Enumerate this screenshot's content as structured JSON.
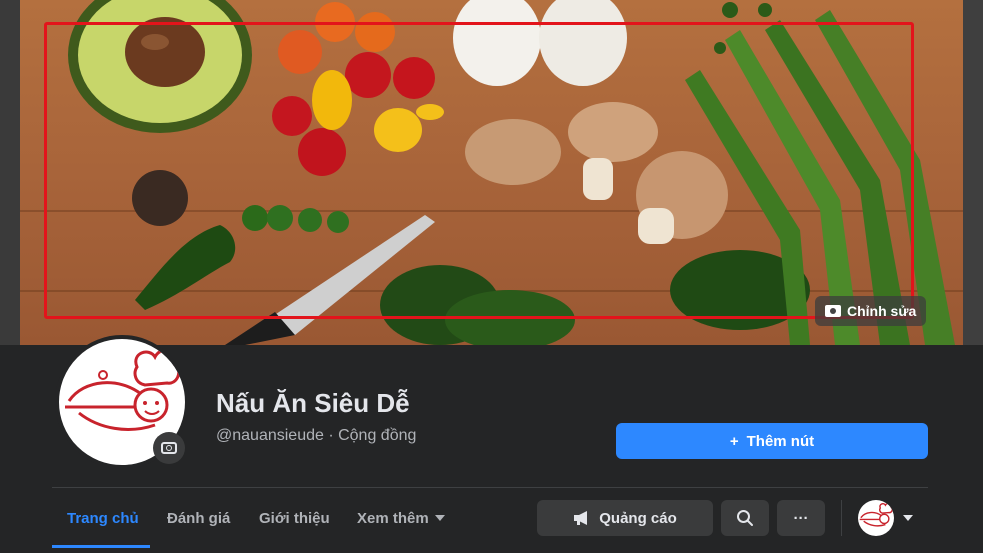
{
  "cover": {
    "edit_label": "Chỉnh sửa"
  },
  "page": {
    "name": "Nấu Ăn Siêu Dễ",
    "handle": "@nauansieude · Cộng đồng"
  },
  "actions": {
    "add_button_label": "Thêm nút",
    "add_button_icon": "+",
    "ads_label": "Quảng cáo",
    "more_label": "···"
  },
  "tabs": [
    {
      "label": "Trang chủ",
      "active": true
    },
    {
      "label": "Đánh giá",
      "active": false
    },
    {
      "label": "Giới thiệu",
      "active": false
    },
    {
      "label": "Xem thêm",
      "active": false
    }
  ],
  "colors": {
    "accent": "#2d88ff",
    "highlight": "#e3141b",
    "logo_red": "#c8232c"
  }
}
